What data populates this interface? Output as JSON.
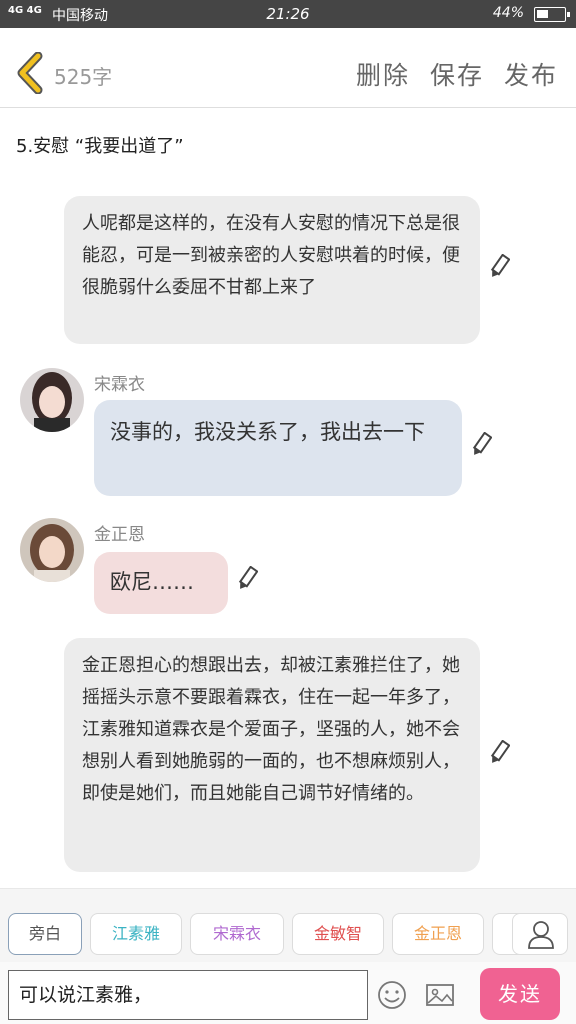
{
  "status_bar": {
    "signal": "4G 4G",
    "carrier": "中国移动",
    "time": "21:26",
    "battery": "44%",
    "battery_level": 0.44
  },
  "header": {
    "word_count": "525字",
    "delete_label": "删除",
    "save_label": "保存",
    "publish_label": "发布"
  },
  "chapter_title": "5.安慰 “我要出道了”",
  "messages": [
    {
      "type": "narration",
      "text": "人呢都是这样的，在没有人安慰的情况下总是很能忍，可是一到被亲密的人安慰哄着的时候，便很脆弱什么委屈不甘都上来了"
    },
    {
      "type": "dialog",
      "speaker": "宋霖衣",
      "text": "没事的，我没关系了，我出去一下",
      "color": "#dde4ee"
    },
    {
      "type": "dialog",
      "speaker": "金正恩",
      "text": "欧尼……",
      "color": "#f3dddd"
    },
    {
      "type": "narration",
      "text": "金正恩担心的想跟出去，却被江素雅拦住了，她摇摇头示意不要跟着霖衣，住在一起一年多了，江素雅知道霖衣是个爱面子，坚强的人，她不会想别人看到她脆弱的一面的，也不想麻烦别人，即使是她们，而且她能自己调节好情绪的。"
    }
  ],
  "roles": [
    {
      "label": "旁白",
      "color": "#555555"
    },
    {
      "label": "江素雅",
      "color": "#3bb3c3"
    },
    {
      "label": "宋霖衣",
      "color": "#b06ad0"
    },
    {
      "label": "金敏智",
      "color": "#e05050"
    },
    {
      "label": "金正恩",
      "color": "#f0a050"
    }
  ],
  "input": {
    "value": "可以说江素雅，"
  },
  "send_label": "发送",
  "icons": {
    "back": "chevron-left-icon",
    "edit": "pencil-icon",
    "user": "user-icon",
    "emoji": "smiley-icon",
    "image": "image-icon"
  },
  "colors": {
    "back_arrow": "#f0c020",
    "send_button": "#f06292"
  }
}
